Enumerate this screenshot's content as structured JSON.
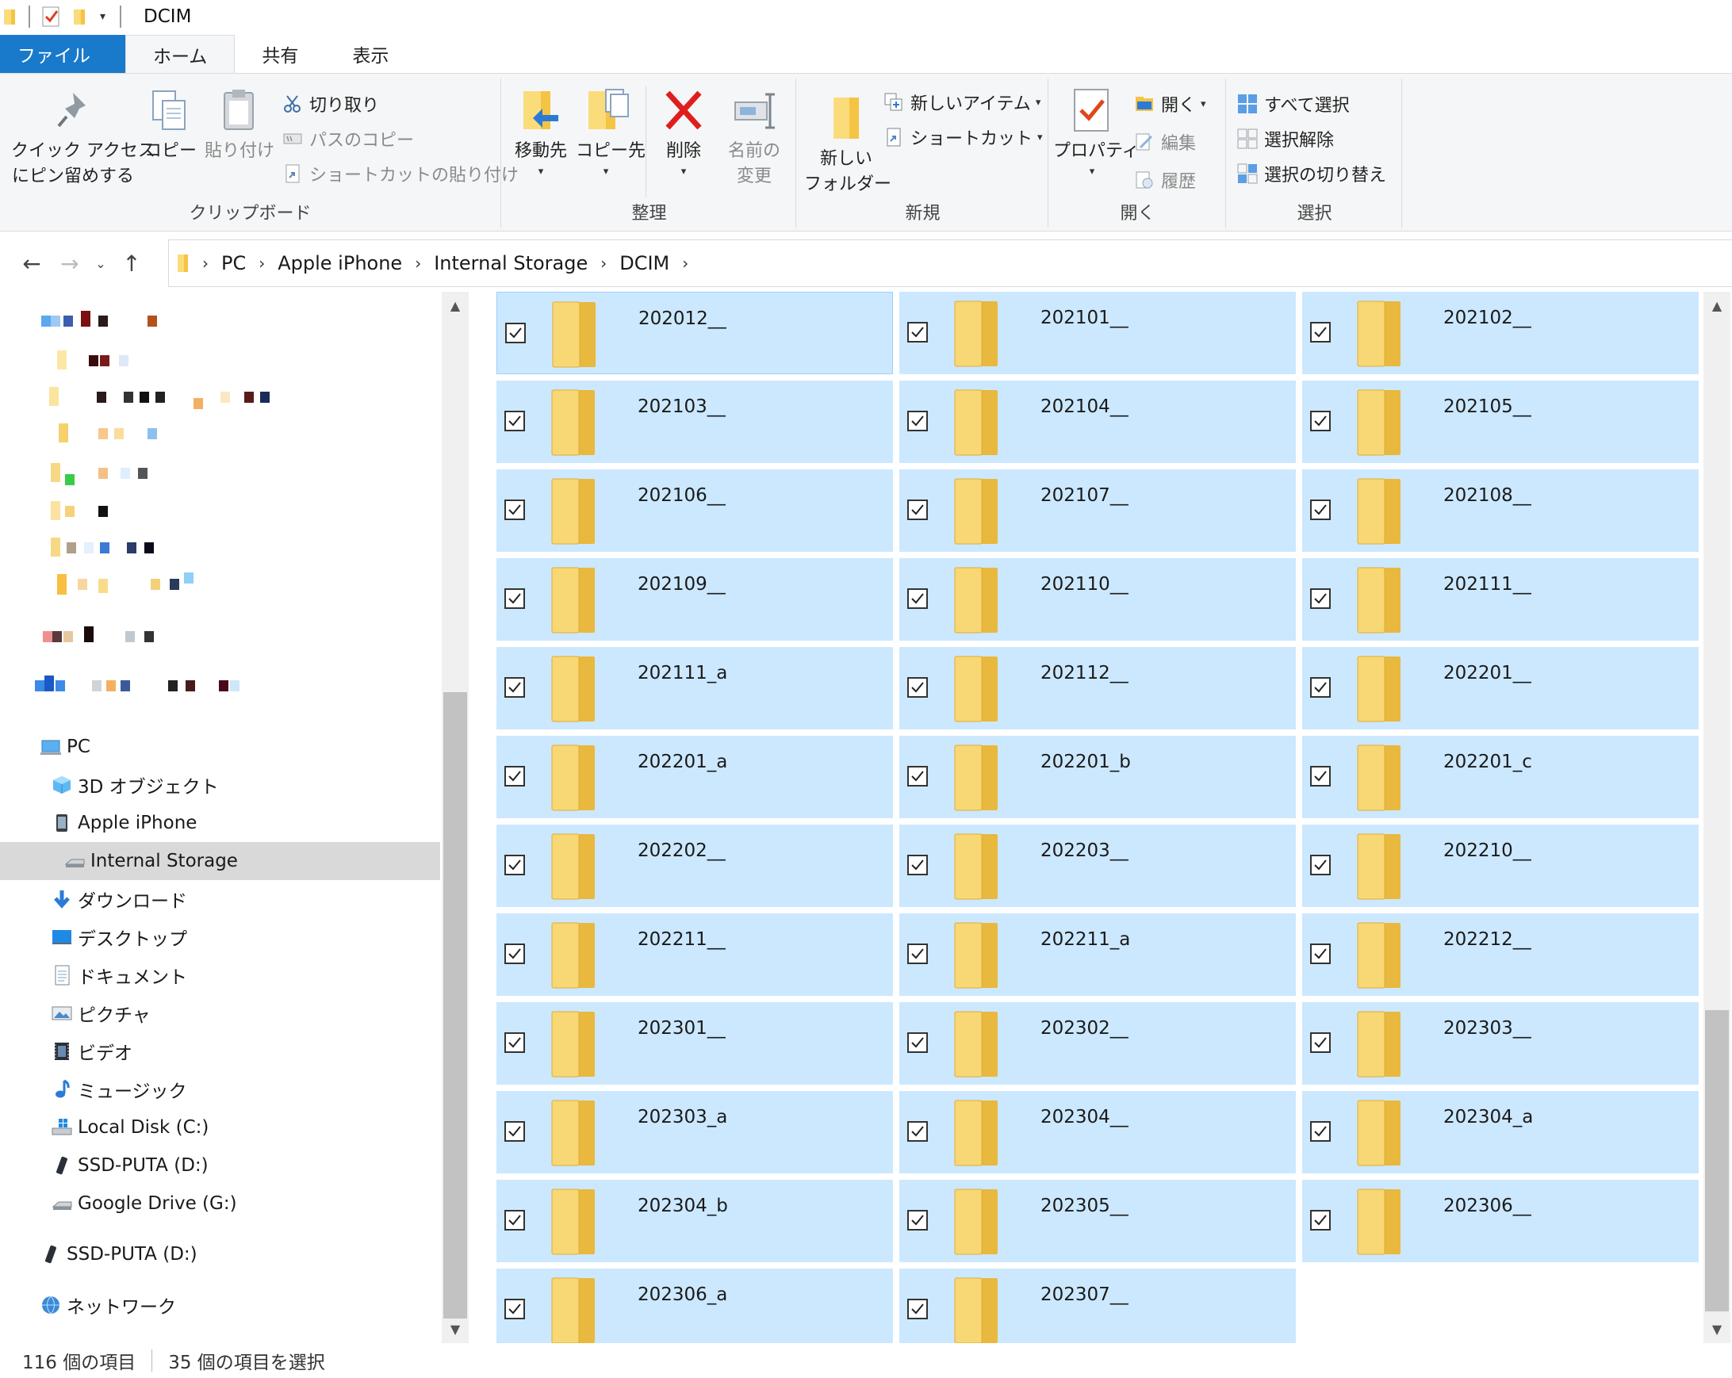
{
  "window": {
    "title": "DCIM"
  },
  "tabs": [
    {
      "label": "ファイル"
    },
    {
      "label": "ホーム"
    },
    {
      "label": "共有"
    },
    {
      "label": "表示"
    }
  ],
  "ribbon": {
    "clipboard": {
      "label": "クリップボード",
      "pin_line1": "クイック アクセス",
      "pin_line2": "にピン留めする",
      "copy": "コピー",
      "paste": "貼り付け",
      "cut": "切り取り",
      "copy_path": "パスのコピー",
      "paste_shortcut": "ショートカットの貼り付け"
    },
    "organize": {
      "label": "整理",
      "move_to": "移動先",
      "copy_to": "コピー先",
      "delete": "削除",
      "rename_line1": "名前の",
      "rename_line2": "変更"
    },
    "new": {
      "label": "新規",
      "new_folder_line1": "新しい",
      "new_folder_line2": "フォルダー",
      "new_item": "新しいアイテム",
      "shortcut": "ショートカット"
    },
    "open": {
      "label": "開く",
      "properties": "プロパティ",
      "open": "開く",
      "edit": "編集",
      "history": "履歴"
    },
    "select": {
      "label": "選択",
      "select_all": "すべて選択",
      "select_none": "選択解除",
      "invert": "選択の切り替え"
    }
  },
  "breadcrumb": [
    "PC",
    "Apple iPhone",
    "Internal Storage",
    "DCIM"
  ],
  "nav_tree": {
    "pc": "PC",
    "objects3d": "3D オブジェクト",
    "iphone": "Apple iPhone",
    "internal": "Internal Storage",
    "downloads": "ダウンロード",
    "desktop": "デスクトップ",
    "documents": "ドキュメント",
    "pictures": "ピクチャ",
    "videos": "ビデオ",
    "music": "ミュージック",
    "local_disk": "Local Disk (C:)",
    "ssd1": "SSD-PUTA (D:)",
    "gdrive": "Google Drive (G:)",
    "ssd2": "SSD-PUTA (D:)",
    "network": "ネットワーク"
  },
  "folders": [
    "202012__",
    "202101__",
    "202102__",
    "202103__",
    "202104__",
    "202105__",
    "202106__",
    "202107__",
    "202108__",
    "202109__",
    "202110__",
    "202111__",
    "202111_a",
    "202112__",
    "202201__",
    "202201_a",
    "202201_b",
    "202201_c",
    "202202__",
    "202203__",
    "202210__",
    "202211__",
    "202211_a",
    "202212__",
    "202301__",
    "202302__",
    "202303__",
    "202303_a",
    "202304__",
    "202304_a",
    "202304_b",
    "202305__",
    "202306__",
    "202306_a",
    "202307__"
  ],
  "status": {
    "item_count": "116 個の項目",
    "selected_count": "35 個の項目を選択"
  },
  "colors": {
    "file_tab": "#1979ca",
    "selection": "#cce8ff",
    "folder": "#f8d775"
  }
}
